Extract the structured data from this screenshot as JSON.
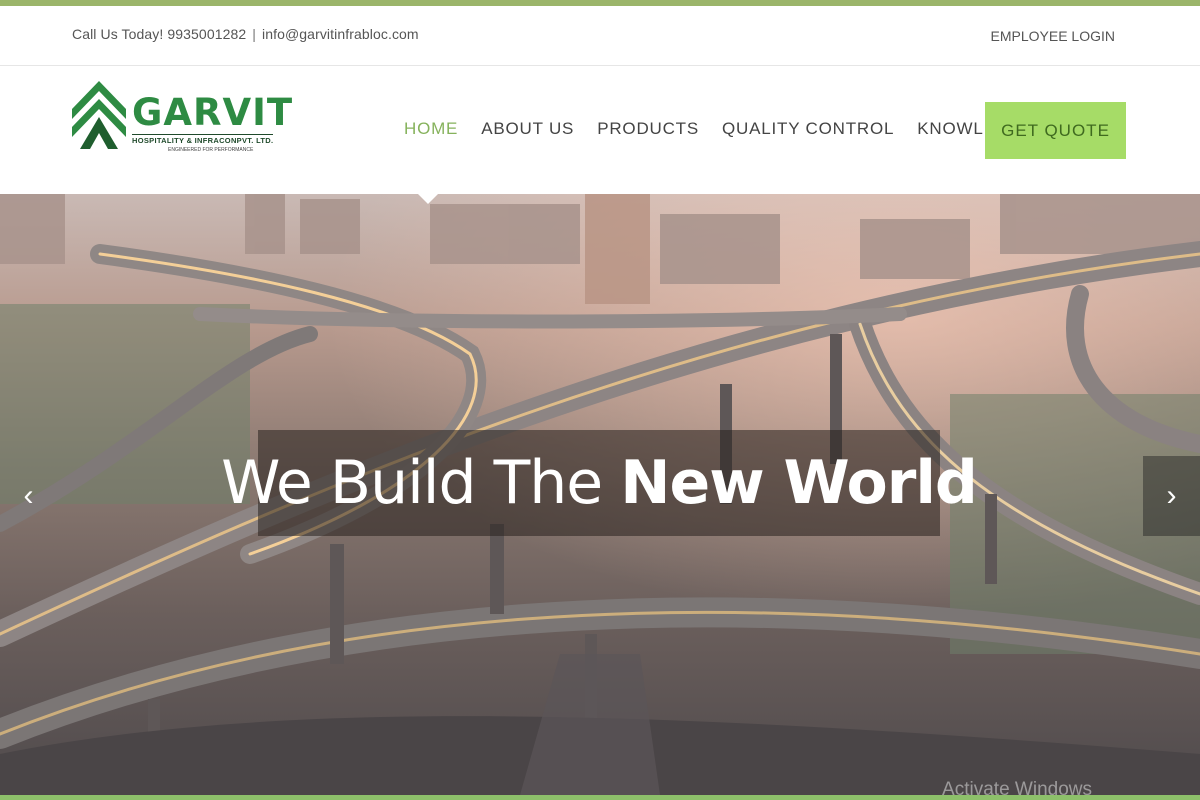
{
  "topbar": {
    "phone_text": "Call Us Today! 9935001282",
    "separator": "|",
    "email_text": "info@garvitinfrabloc.com",
    "login_label": "EMPLOYEE LOGIN"
  },
  "logo": {
    "name": "GARVIT",
    "subtitle": "HOSPITALITY & INFRACONPVT. LTD.",
    "tagline": "ENGINEERED FOR PERFORMANCE",
    "icon": "chevron-stack-logo-icon",
    "brand_color": "#2e8b43"
  },
  "nav": {
    "items": [
      {
        "label": "HOME",
        "active": true
      },
      {
        "label": "ABOUT US"
      },
      {
        "label": "PRODUCTS"
      },
      {
        "label": "QUALITY CONTROL"
      },
      {
        "label": "KNOWLEDGE BASE"
      }
    ],
    "active_color": "#86b25c",
    "quote_label": "GET QUOTE",
    "quote_color": "#a6dc67"
  },
  "hero": {
    "headline_light": "We Build The ",
    "headline_bold": "New World",
    "prev_icon": "chevron-left-icon",
    "next_icon": "chevron-right-icon",
    "prev_glyph": "‹",
    "next_glyph": "›"
  },
  "watermark": {
    "text": "Activate Windows"
  }
}
